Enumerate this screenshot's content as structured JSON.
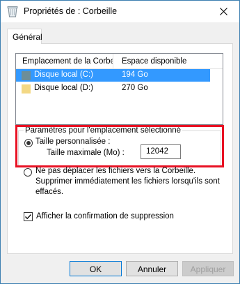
{
  "window": {
    "title": "Propriétés de : Corbeille"
  },
  "tabs": [
    {
      "label": "Général"
    }
  ],
  "list": {
    "columns": [
      "Emplacement de la Corbeille",
      "Espace disponible"
    ],
    "rows": [
      {
        "name": "Disque local (C:)",
        "space": "194 Go",
        "selected": true,
        "color": "#6d8e99"
      },
      {
        "name": "Disque local (D:)",
        "space": "270 Go",
        "selected": false,
        "color": "#f3d884"
      }
    ]
  },
  "settings": {
    "group_title": "Paramètres pour l'emplacement sélectionné",
    "custom_size_label": "Taille personnalisée :",
    "max_size_label": "Taille maximale (Mo) :",
    "max_size_value": "12042",
    "no_move_label_line1": "Ne pas déplacer les fichiers vers la Corbeille.",
    "no_move_label_line2": "Supprimer immédiatement les fichiers lorsqu'ils sont",
    "no_move_label_line3": "effacés.",
    "confirm_label": "Afficher la confirmation de suppression"
  },
  "buttons": {
    "ok": "OK",
    "cancel": "Annuler",
    "apply": "Appliquer"
  },
  "colors": {
    "selection": "#3399ff",
    "highlight_border": "#e81123",
    "primary_border": "#0078d7"
  },
  "icons": {
    "title": "recycle-bin-icon",
    "close": "close-icon",
    "checkbox": "checkmark-icon"
  }
}
